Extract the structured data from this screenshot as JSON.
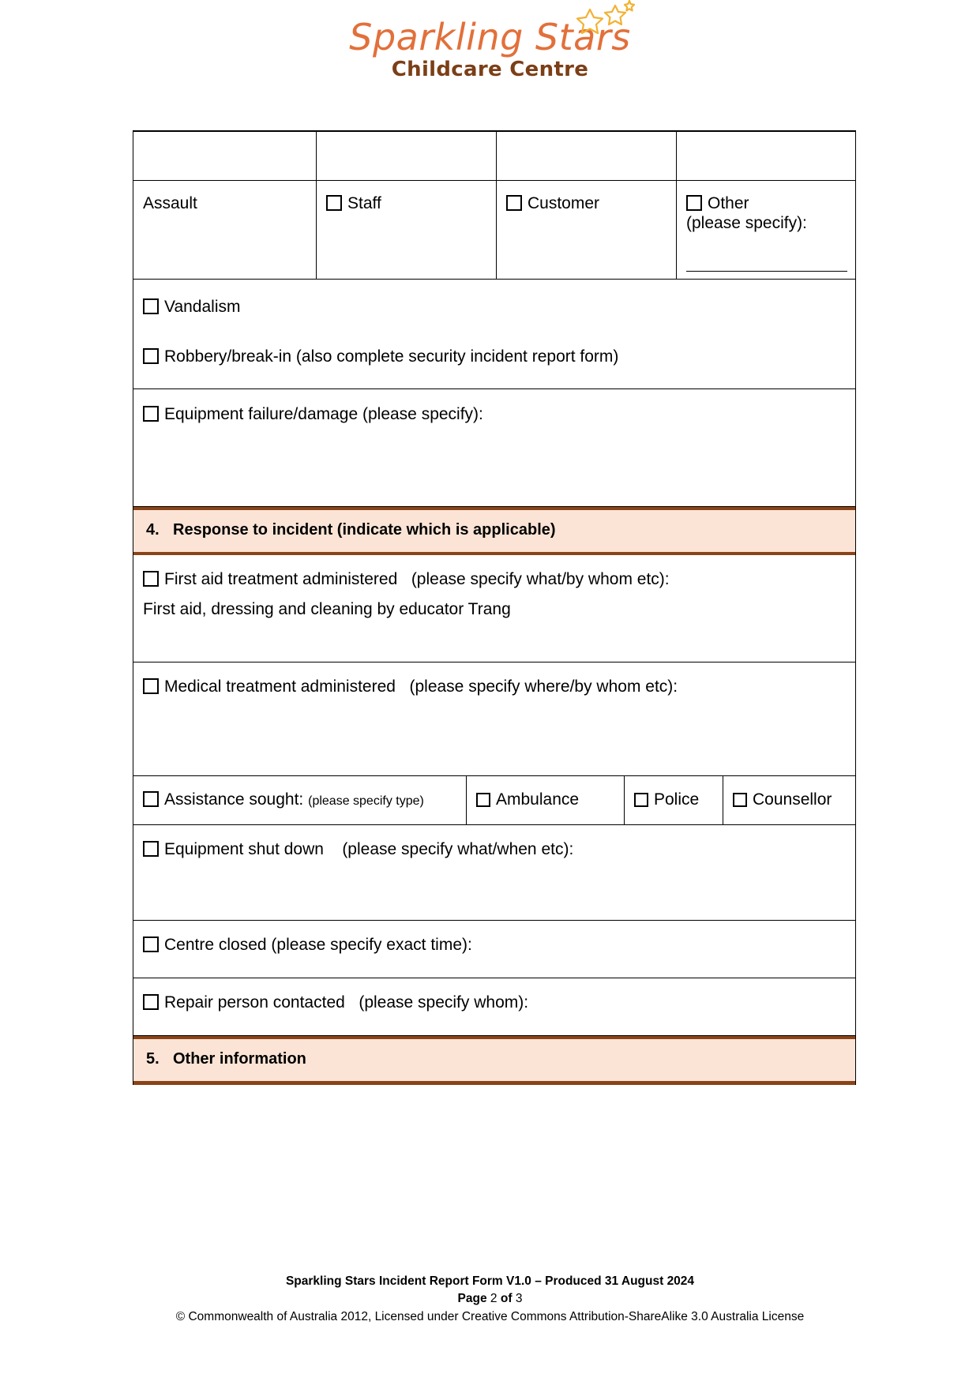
{
  "logo": {
    "title": "Sparkling Stars",
    "subtitle": "Childcare Centre",
    "title_color": "#E2703A",
    "subtitle_color": "#7B3F17",
    "star_color": "#F2B233"
  },
  "form": {
    "incident_types": {
      "assault_label": "Assault",
      "staff_label": "Staff",
      "customer_label": "Customer",
      "other_label": "Other",
      "other_specify": "(please specify):",
      "vandalism_label": "Vandalism",
      "robbery_label": "Robbery/break-in (also complete security incident report form)",
      "equipment_failure_label": "Equipment failure/damage (please specify):"
    },
    "section4": {
      "number": "4.",
      "title": "Response to incident (indicate which is applicable)",
      "band_bg": "#FBE4D5",
      "band_border": "#8A4418",
      "first_aid_label": "First aid treatment administered",
      "first_aid_specify": "(please specify what/by whom etc):",
      "first_aid_value": "First aid, dressing and cleaning by educator Trang",
      "medical_label": "Medical treatment administered",
      "medical_specify": "(please specify where/by whom etc):",
      "assistance_label": "Assistance sought:",
      "assistance_specify": "(please specify type)",
      "ambulance_label": "Ambulance",
      "police_label": "Police",
      "counsellor_label": "Counsellor",
      "equipment_shutdown_label": "Equipment shut down",
      "equipment_shutdown_specify": "(please specify what/when etc):",
      "centre_closed_label": "Centre closed (please specify exact time):",
      "repair_person_label": "Repair person contacted",
      "repair_person_specify": "(please specify whom):"
    },
    "section5": {
      "number": "5.",
      "title": "Other information"
    }
  },
  "footer": {
    "line1": "Sparkling Stars Incident Report Form V1.0 – Produced 31 August 2024",
    "page_word": "Page",
    "page_number": "2",
    "of_word": "of",
    "page_total": "3",
    "line3": "© Commonwealth of Australia 2012, Licensed under Creative Commons Attribution-ShareAlike 3.0 Australia License"
  }
}
